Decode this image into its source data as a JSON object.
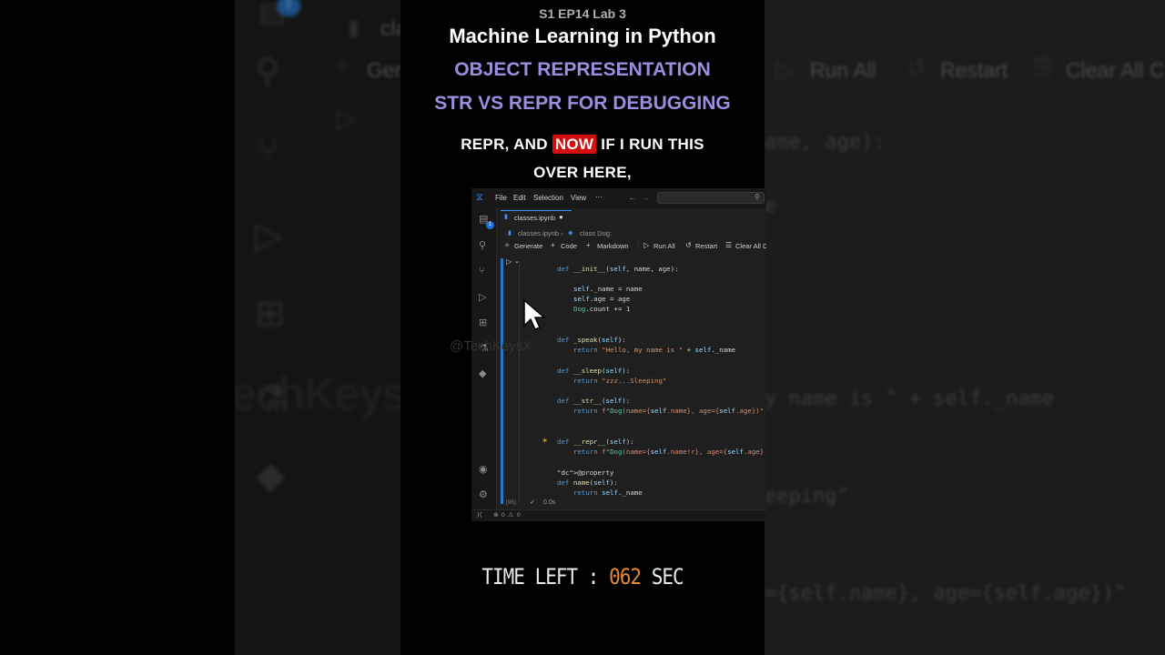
{
  "header": {
    "episode": "S1 EP14 Lab 3",
    "title": "Machine Learning in Python",
    "topic": "OBJECT REPRESENTATION",
    "subtopic": "STR VS REPR FOR DEBUGGING"
  },
  "caption": {
    "before": "REPR, AND ",
    "highlight": "NOW",
    "after": " IF I RUN THIS",
    "line2": "OVER HERE,"
  },
  "watermark": "@TechKeysX",
  "background": {
    "tab_fragment": "cla",
    "toolbar": {
      "generate_fragment": "Gene",
      "run_all": "Run All",
      "restart": "Restart",
      "clear_all_fragment": "Clear All C"
    },
    "code_fragments": [
      "ame, age):",
      "e",
      "y name is \" + self._name",
      "eeping\"",
      "={self.name}, age={self.age})\""
    ],
    "badge": "1"
  },
  "editor": {
    "menu": [
      "File",
      "Edit",
      "Selection",
      "View",
      "···"
    ],
    "tab_label": "classes.ipynb",
    "breadcrumb": [
      "classes.ipynb",
      "class Dog:"
    ],
    "toolbar": {
      "generate": "Generate",
      "code": "Code",
      "markdown": "Markdown",
      "run_all": "Run All",
      "restart": "Restart",
      "clear_all": "Clear All C"
    },
    "explorer_badge": "1",
    "exec_count": "[95]",
    "exec_time": "0.0s",
    "status": {
      "errors": "0",
      "warnings": "0"
    }
  },
  "code_lines": [
    "def __init__(self, name, age):",
    "self._name = name",
    "self.age = age",
    "Dog.count += 1",
    "def _speak(self):",
    "return \"Hello, my name is \" + self._name",
    "def __sleep(self):",
    "return \"zzz...Sleeping\"",
    "def __str__(self):",
    "return f\"Dog(name={self.name}, age={self.age})\"",
    "def __repr__(self):",
    "return f\"Dog(name={self.name!r}, age={self.age}",
    "@property",
    "def name(self):",
    "return self._name"
  ],
  "timer": {
    "label": "TIME LEFT :",
    "value": "062",
    "unit": "SEC"
  },
  "colors": {
    "accent_purple": "#9a8ee0",
    "highlight_red": "#d40e0e",
    "timer_orange": "#e08a3c",
    "vscode_blue": "#3794ff"
  }
}
